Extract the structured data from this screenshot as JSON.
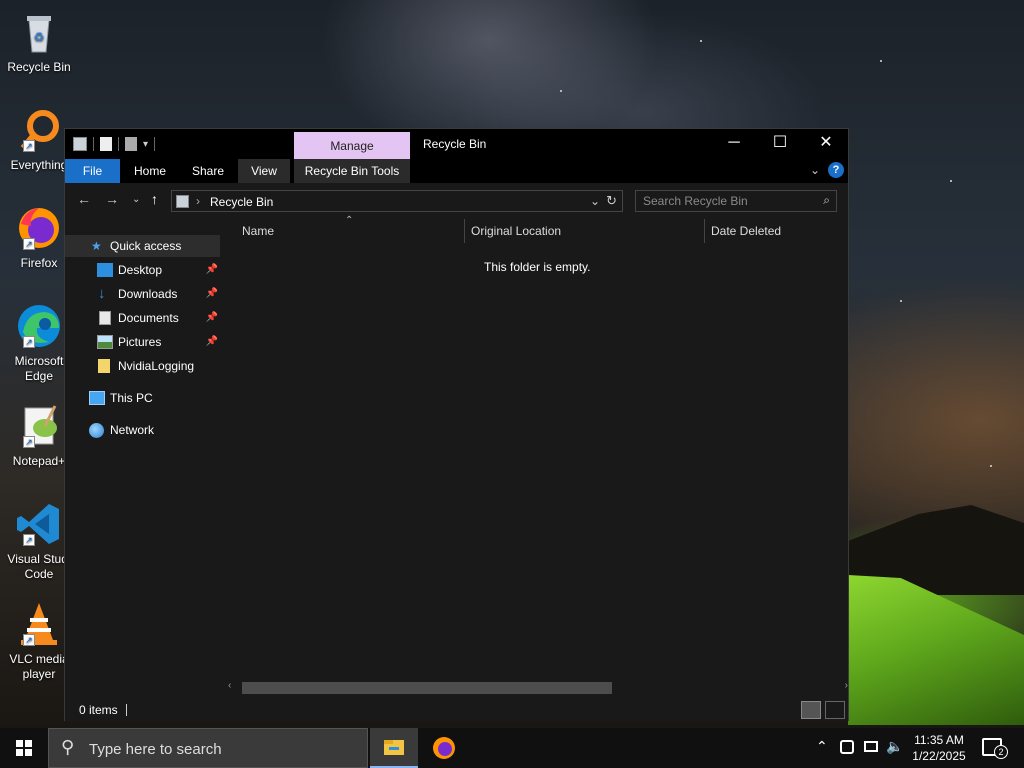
{
  "desktop": {
    "icons": [
      {
        "label": "Recycle Bin"
      },
      {
        "label": "Everything"
      },
      {
        "label": "Firefox"
      },
      {
        "label": "Microsoft Edge",
        "line1": "Microsoft",
        "line2": "Edge"
      },
      {
        "label": "Notepad++",
        "line1": "Notepad+"
      },
      {
        "label": "Visual Studio Code",
        "line1": "Visual Studi",
        "line2": "Code"
      },
      {
        "label": "VLC media player",
        "line1": "VLC media",
        "line2": "player"
      }
    ]
  },
  "window": {
    "title": "Recycle Bin",
    "manage_tab": "Manage",
    "ribbon_tabs": [
      "File",
      "Home",
      "Share",
      "View",
      "Recycle Bin Tools"
    ],
    "address": "Recycle Bin",
    "search_placeholder": "Search Recycle Bin",
    "nav": {
      "quick_access": "Quick access",
      "items": [
        "Desktop",
        "Downloads",
        "Documents",
        "Pictures",
        "NvidiaLogging"
      ],
      "this_pc": "This PC",
      "network": "Network"
    },
    "columns": [
      "Name",
      "Original Location",
      "Date Deleted"
    ],
    "empty_message": "This folder is empty.",
    "status": "0 items"
  },
  "taskbar": {
    "search_placeholder": "Type here to search",
    "time": "11:35 AM",
    "date": "1/22/2025",
    "notification_count": "2"
  }
}
